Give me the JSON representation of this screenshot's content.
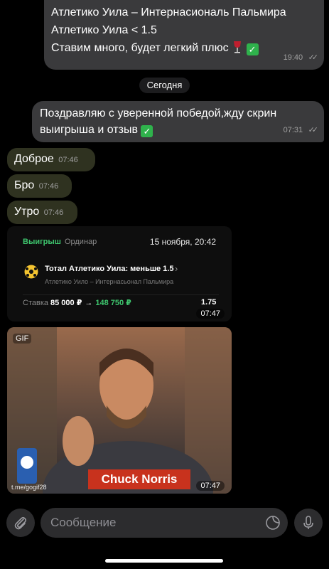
{
  "messages": {
    "out1": {
      "line1": "Атлетико Уила – Интернасиональ Пальмира",
      "line2": "Атлетико Уила < 1.5",
      "line3": "Ставим много, будет легкий плюс",
      "time": "19:40"
    },
    "date_chip": "Сегодня",
    "out2": {
      "line1": "Поздравляю с уверенной победой,жду скрин",
      "line2": "выигрыша и отзыв",
      "time": "07:31"
    },
    "in1": {
      "text": "Доброе",
      "time": "07:46"
    },
    "in2": {
      "text": "Бро",
      "time": "07:46"
    },
    "in3": {
      "text": "Утро",
      "time": "07:46"
    }
  },
  "bet_card": {
    "status": "Выигрыш",
    "type": "Ординар",
    "date": "15 ноября, 20:42",
    "selection": "Тотал Атлетико Уила: меньше 1.5",
    "match": "Атлетико Уило – Интернасьонал Пальмира",
    "stake_label": "Ставка",
    "stake": "85 000 ₽",
    "payout": "148 750 ₽",
    "odds": "1.75",
    "time": "07:47"
  },
  "gif": {
    "label": "GIF",
    "watermark": "t.me/gogif28",
    "banner": "Chuck Norris",
    "time": "07:47"
  },
  "input": {
    "placeholder": "Сообщение"
  },
  "icons": {
    "attach": "paperclip-icon",
    "sticker": "sticker-icon",
    "mic": "microphone-icon",
    "read": "double-check-icon"
  },
  "colors": {
    "outgoing_bubble": "#3a3a3c",
    "incoming_bubble": "#2f3220",
    "win_green": "#3ec46d",
    "check_green": "#2fb24c"
  }
}
